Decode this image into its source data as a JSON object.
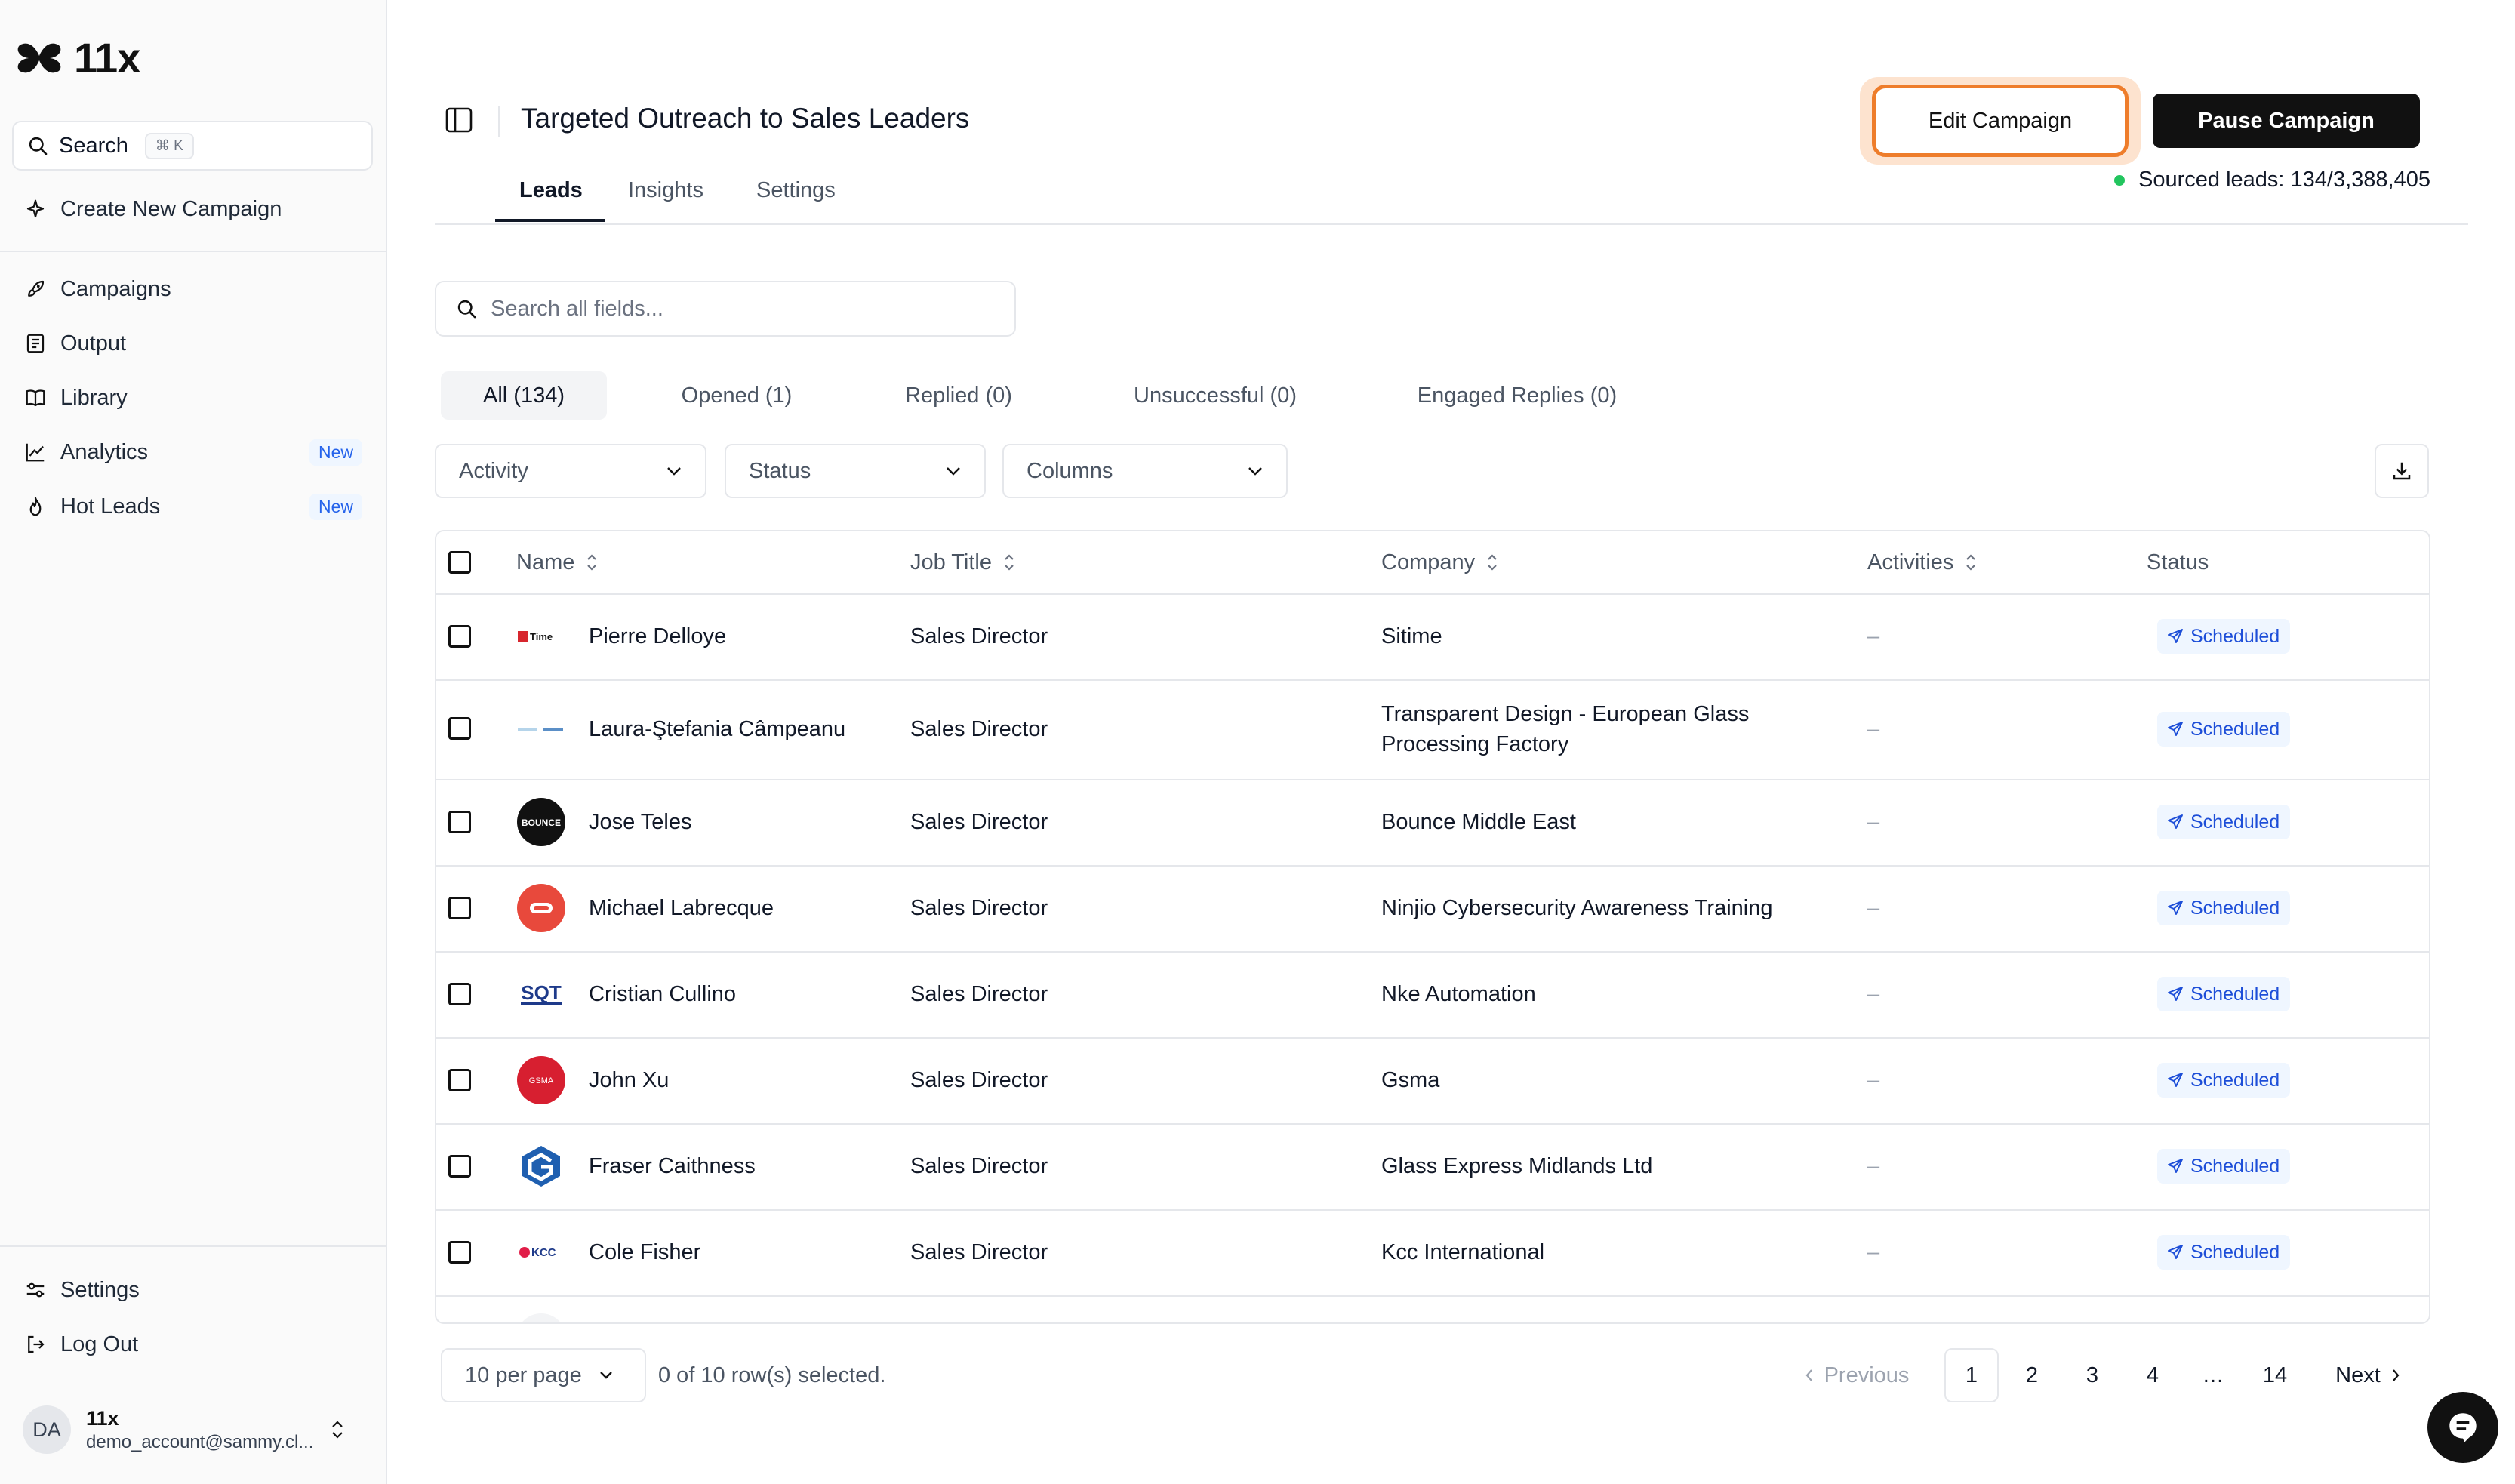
{
  "app": {
    "name": "11x"
  },
  "sidebar": {
    "search_label": "Search",
    "search_shortcut": "⌘ K",
    "create_label": "Create New Campaign",
    "items": [
      {
        "label": "Campaigns",
        "icon": "rocket-icon",
        "badge": ""
      },
      {
        "label": "Output",
        "icon": "document-icon",
        "badge": ""
      },
      {
        "label": "Library",
        "icon": "book-icon",
        "badge": ""
      },
      {
        "label": "Analytics",
        "icon": "chart-line-icon",
        "badge": "New"
      },
      {
        "label": "Hot Leads",
        "icon": "flame-icon",
        "badge": "New"
      }
    ],
    "settings_label": "Settings",
    "logout_label": "Log Out",
    "account": {
      "initials": "DA",
      "name": "11x",
      "email": "demo_account@sammy.cl..."
    }
  },
  "header": {
    "title": "Targeted Outreach to Sales Leaders",
    "tabs": [
      "Leads",
      "Insights",
      "Settings"
    ],
    "active_tab": "Leads",
    "edit_label": "Edit Campaign",
    "pause_label": "Pause Campaign",
    "sourced_label": "Sourced leads: 134/3,388,405",
    "accent_color": "#ee7d2b",
    "status_color": "#22c55e"
  },
  "filters": {
    "search_placeholder": "Search all fields...",
    "tabs": [
      "All (134)",
      "Opened (1)",
      "Replied (0)",
      "Unsuccessful (0)",
      "Engaged Replies (0)"
    ],
    "dropdowns": [
      "Activity",
      "Status",
      "Columns"
    ]
  },
  "table": {
    "columns": [
      "Name",
      "Job Title",
      "Company",
      "Activities",
      "Status"
    ],
    "rows": [
      {
        "name": "Pierre Delloye",
        "job_title": "Sales Director",
        "company": "Sitime",
        "activities": "–",
        "status": "Scheduled",
        "logo": "sitime-logo"
      },
      {
        "name": "Laura-Ştefania Câmpeanu",
        "job_title": "Sales Director",
        "company": "Transparent Design - European Glass Processing Factory",
        "activities": "–",
        "status": "Scheduled",
        "logo": "transparent-design-logo"
      },
      {
        "name": "Jose Teles",
        "job_title": "Sales Director",
        "company": "Bounce Middle East",
        "activities": "–",
        "status": "Scheduled",
        "logo": "bounce-logo"
      },
      {
        "name": "Michael Labrecque",
        "job_title": "Sales Director",
        "company": "Ninjio Cybersecurity Awareness Training",
        "activities": "–",
        "status": "Scheduled",
        "logo": "ninjio-logo"
      },
      {
        "name": "Cristian Cullino",
        "job_title": "Sales Director",
        "company": "Nke Automation",
        "activities": "–",
        "status": "Scheduled",
        "logo": "sqt-logo"
      },
      {
        "name": "John Xu",
        "job_title": "Sales Director",
        "company": "Gsma",
        "activities": "–",
        "status": "Scheduled",
        "logo": "gsma-logo"
      },
      {
        "name": "Fraser Caithness",
        "job_title": "Sales Director",
        "company": "Glass Express Midlands Ltd",
        "activities": "–",
        "status": "Scheduled",
        "logo": "glass-express-logo"
      },
      {
        "name": "Cole Fisher",
        "job_title": "Sales Director",
        "company": "Kcc International",
        "activities": "–",
        "status": "Scheduled",
        "logo": "kcc-logo"
      }
    ]
  },
  "pagination": {
    "per_page": "10 per page",
    "selected_text": "0 of 10 row(s) selected.",
    "previous": "Previous",
    "pages": [
      "1",
      "2",
      "3",
      "4",
      "…",
      "14"
    ],
    "current_page": "1",
    "next": "Next"
  }
}
